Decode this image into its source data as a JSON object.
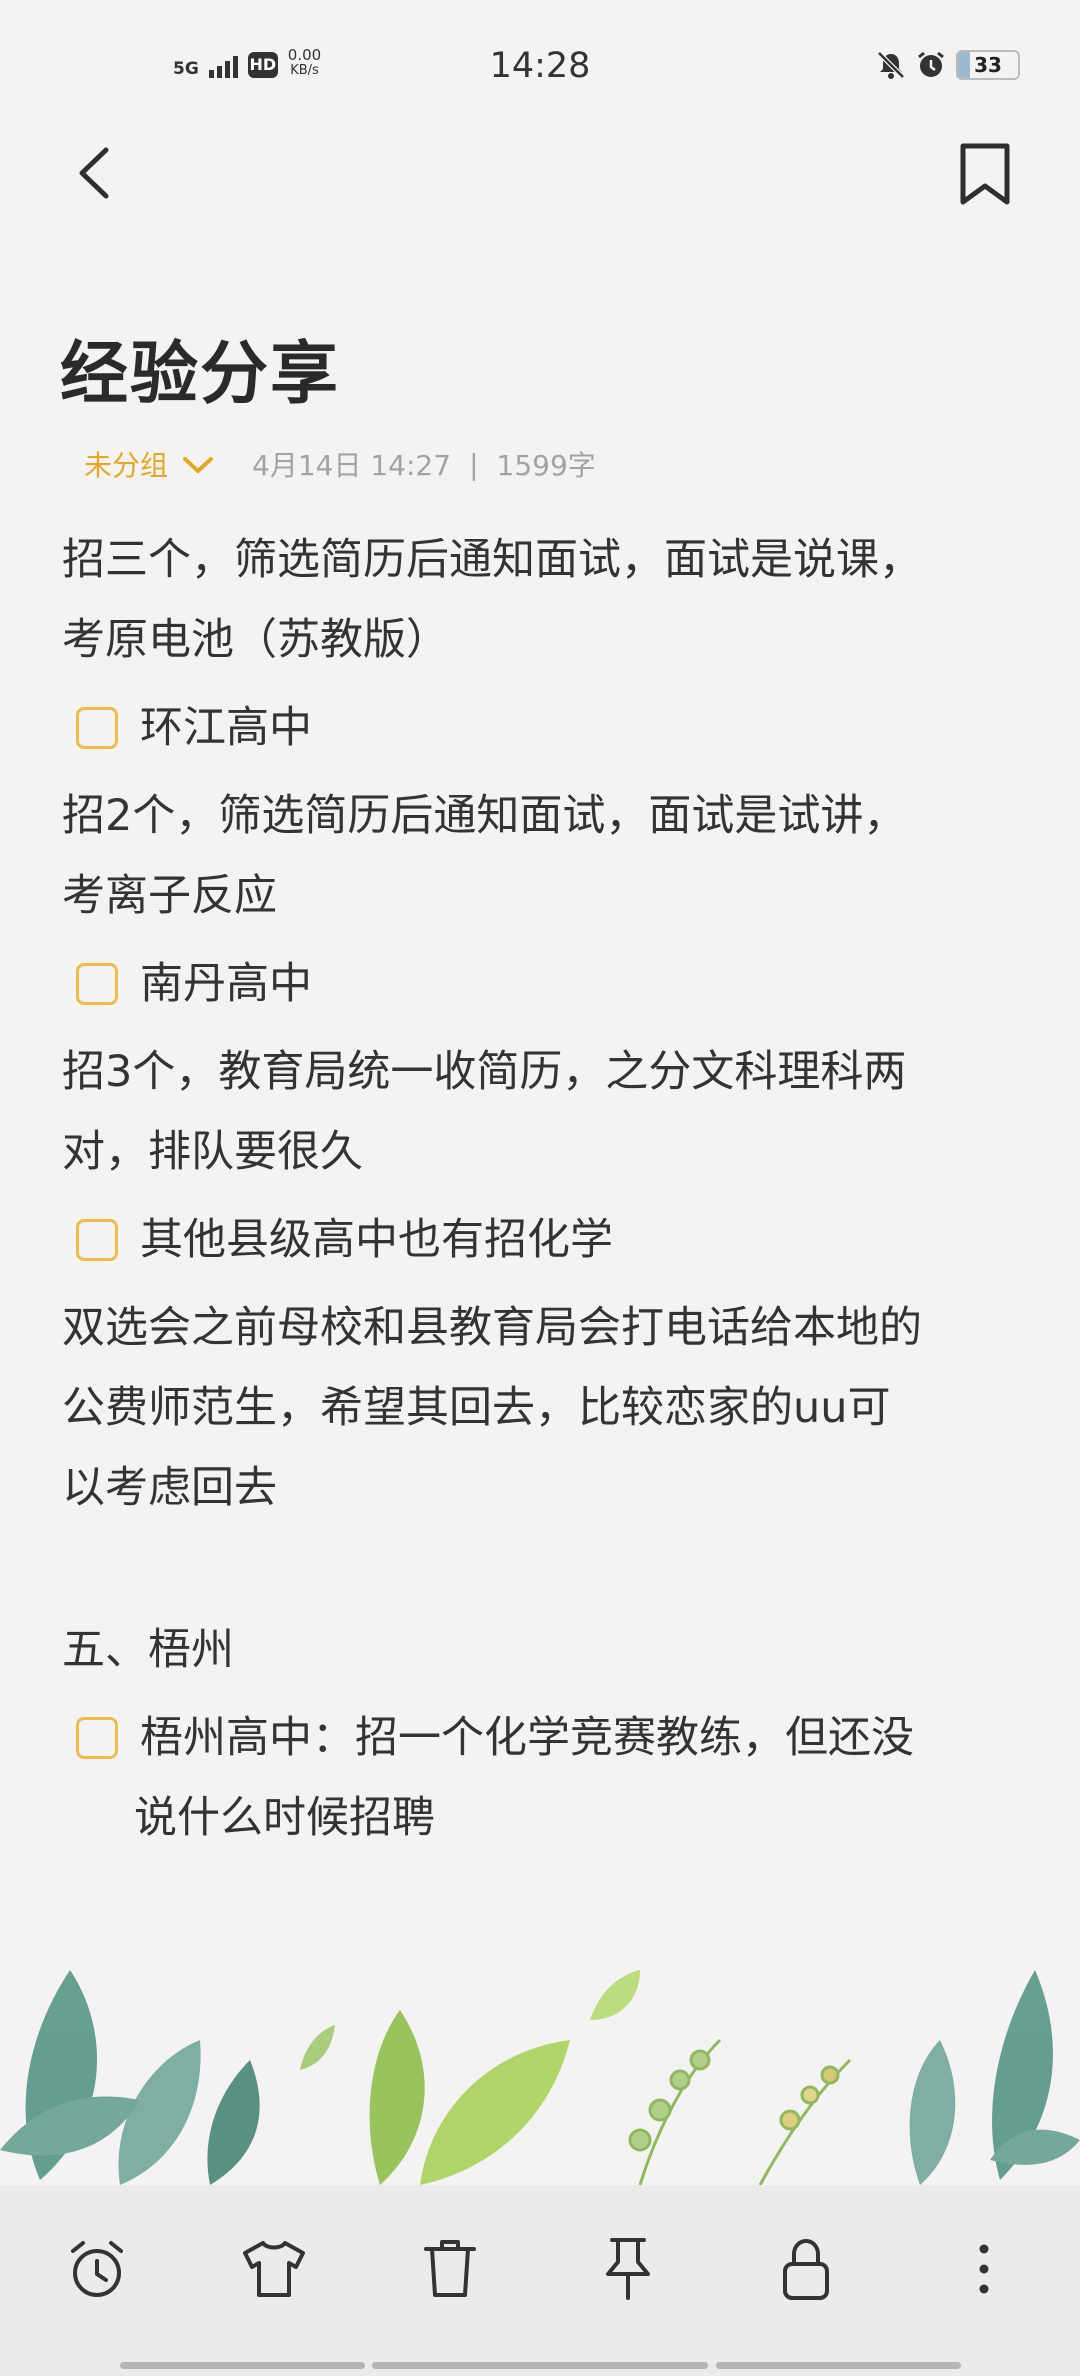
{
  "status_bar": {
    "network": "5G",
    "hd": "HD",
    "speed_value": "0.00",
    "speed_unit": "KB/s",
    "time": "14:28",
    "battery": "33"
  },
  "note": {
    "title": "经验分享",
    "group_label": "未分组",
    "date": "4月14日 14:27",
    "separator": "|",
    "word_count": "1599字",
    "para1_line1": "招三个，筛选简历后通知面试，面试是说课，",
    "para1_line2": "考原电池（苏教版）",
    "todo1": "环江高中",
    "para2_line1": "招2个，筛选简历后通知面试，面试是试讲，",
    "para2_line2": "考离子反应",
    "todo2": "南丹高中",
    "para3_line1": "招3个，教育局统一收简历，之分文科理科两",
    "para3_line2": "对，排队要很久",
    "todo3": "其他县级高中也有招化学",
    "para4_line1": "双选会之前母校和县教育局会打电话给本地的",
    "para4_line2": "公费师范生，希望其回去，比较恋家的uu可",
    "para4_line3": "以考虑回去",
    "section5": "五、梧州",
    "todo4_line1": "梧州高中：招一个化学竞赛教练，但还没",
    "todo4_line2": "说什么时候招聘"
  },
  "icons": {
    "back": "back-arrow-icon",
    "bookmark": "bookmark-icon",
    "toolbar": [
      "alarm-icon",
      "shirt-icon",
      "trash-icon",
      "pin-icon",
      "lock-icon",
      "more-icon"
    ]
  },
  "colors": {
    "accent": "#e0a82c",
    "checkbox": "#ecbc54",
    "background": "#f4f3f1",
    "toolbar": "#ebebea"
  }
}
